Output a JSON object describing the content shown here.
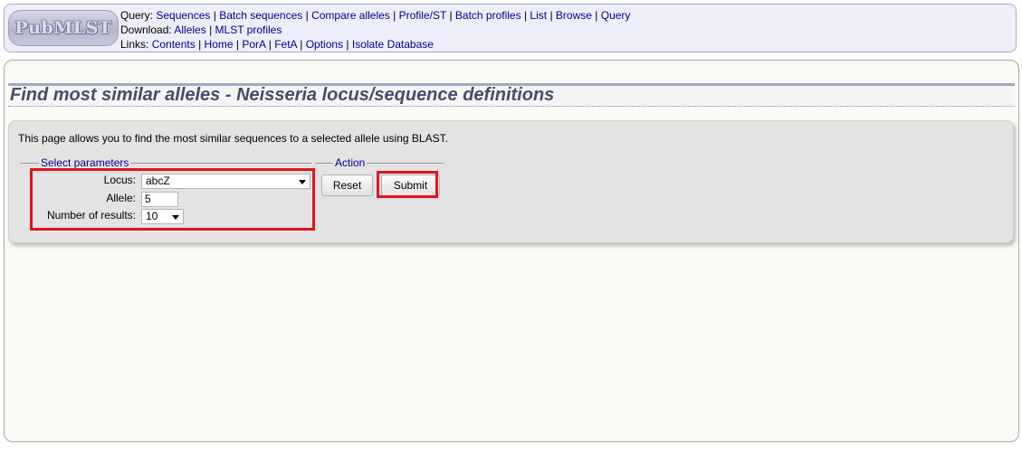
{
  "logo": {
    "text": "PubMLST"
  },
  "menu": {
    "query_label": "Query:",
    "query_links": [
      "Sequences",
      "Batch sequences",
      "Compare alleles",
      "Profile/ST",
      "Batch profiles",
      "List",
      "Browse",
      "Query"
    ],
    "download_label": "Download:",
    "download_links": [
      "Alleles",
      "MLST profiles"
    ],
    "links_label": "Links:",
    "links_links": [
      "Contents",
      "Home",
      "PorA",
      "FetA",
      "Options",
      "Isolate Database"
    ]
  },
  "page": {
    "title": "Find most similar alleles - Neisseria locus/sequence definitions",
    "intro": "This page allows you to find the most similar sequences to a selected allele using BLAST."
  },
  "parameters": {
    "legend": "Select parameters",
    "locus_label": "Locus:",
    "locus_value": "abcZ",
    "allele_label": "Allele:",
    "allele_value": "5",
    "results_label": "Number of results:",
    "results_value": "10"
  },
  "action": {
    "legend": "Action",
    "reset_label": "Reset",
    "submit_label": "Submit"
  },
  "highlight_color": "#e4141b"
}
